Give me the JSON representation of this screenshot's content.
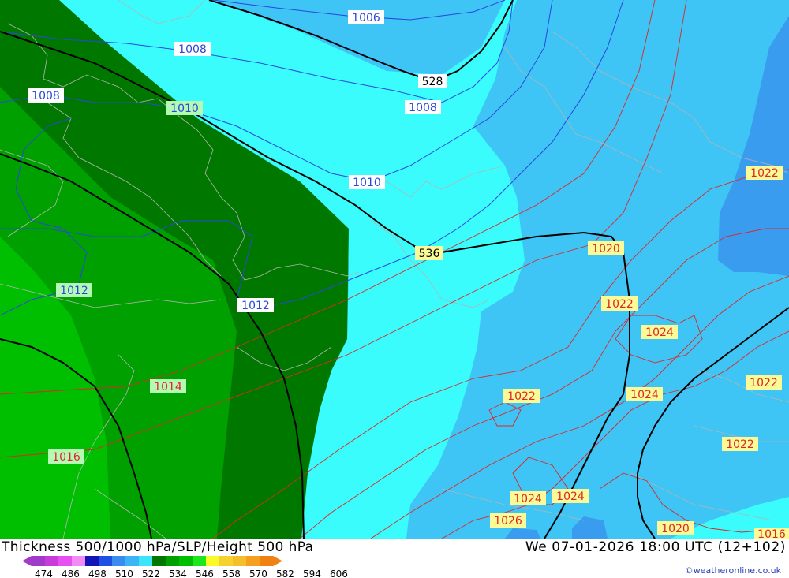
{
  "title": "Thickness 500/1000 hPa/SLP/Height 500 hPa",
  "datetime": "We 07-01-2026 18:00 UTC (12+102)",
  "credit": "©weatheronline.co.uk",
  "legend": {
    "colors": [
      "#a03cc8",
      "#c83cdc",
      "#e650f0",
      "#f28cf5",
      "#1414b4",
      "#1e50e6",
      "#3c8cf0",
      "#3cb4f5",
      "#3ce6fa",
      "#007800",
      "#00a000",
      "#00be00",
      "#1ee61e",
      "#fafa28",
      "#f5d22d",
      "#f5be2d",
      "#f5a01e",
      "#f08214"
    ],
    "ticks": [
      "474",
      "486",
      "498",
      "510",
      "522",
      "534",
      "546",
      "558",
      "570",
      "582",
      "594",
      "606"
    ]
  },
  "labels": {
    "slp": [
      "1006",
      "1008",
      "1008",
      "1008",
      "1010",
      "1010",
      "1012",
      "1012",
      "1014",
      "1016",
      "1020",
      "1022",
      "1022",
      "1022",
      "1022",
      "1022",
      "1022",
      "1024",
      "1024",
      "1024",
      "1024",
      "1026",
      "1020",
      "1016"
    ],
    "height": [
      "528",
      "536"
    ]
  }
}
